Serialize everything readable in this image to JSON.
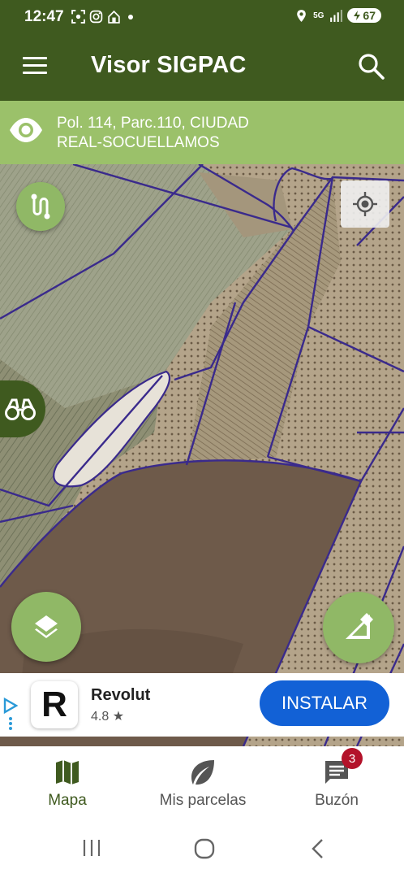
{
  "status_bar": {
    "time": "12:47",
    "network": "5G",
    "battery": "67"
  },
  "app_bar": {
    "title": "Visor SIGPAC"
  },
  "parcel_info": {
    "line1": "Pol. 114, Parc.110, CIUDAD",
    "line2": "REAL-SOCUELLAMOS"
  },
  "ad": {
    "advertiser": "Revolut",
    "logo_letter": "R",
    "rating": "4.8 ★",
    "cta": "INSTALAR"
  },
  "bottom_nav": {
    "items": [
      {
        "label": "Mapa",
        "icon": "map-icon",
        "active": true
      },
      {
        "label": "Mis parcelas",
        "icon": "leaf-icon",
        "active": false
      },
      {
        "label": "Buzón",
        "icon": "message-icon",
        "active": false,
        "badge": "3"
      }
    ]
  },
  "colors": {
    "primary": "#3f5a1f",
    "primary_light": "#9bc16a",
    "fab": "#90b866",
    "parcel_border": "#3a2a8c",
    "ad_button": "#1261d6",
    "badge": "#b3122a"
  }
}
